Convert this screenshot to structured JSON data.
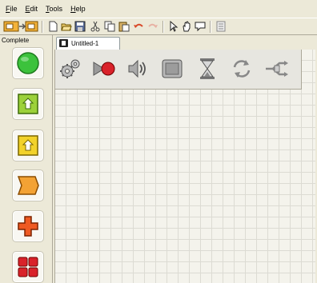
{
  "menu": {
    "file_underline": "F",
    "file_rest": "ile",
    "edit_underline": "E",
    "edit_rest": "dit",
    "tools_underline": "T",
    "tools_rest": "ools",
    "help_underline": "H",
    "help_rest": "elp"
  },
  "palette": {
    "label": "Complete",
    "items": [
      {
        "icon": "green-circle-icon",
        "color": "#3cc23c"
      },
      {
        "icon": "green-arrow-up-icon",
        "color": "#9cd13a"
      },
      {
        "icon": "yellow-arrow-up-icon",
        "color": "#f2d22a"
      },
      {
        "icon": "orange-flag-icon",
        "color": "#f3a234"
      },
      {
        "icon": "orange-cross-icon",
        "color": "#ef5a22"
      },
      {
        "icon": "red-grid-icon",
        "color": "#d9222a"
      }
    ]
  },
  "tabs": [
    {
      "label": "Untitled-1"
    }
  ],
  "blocks": [
    {
      "icon": "gears-icon"
    },
    {
      "icon": "record-play-icon"
    },
    {
      "icon": "speaker-icon"
    },
    {
      "icon": "display-icon"
    },
    {
      "icon": "hourglass-icon"
    },
    {
      "icon": "loop-arrows-icon"
    },
    {
      "icon": "switch-icon"
    }
  ],
  "toolbar": {
    "icons": [
      "program-icon",
      "new-icon",
      "open-icon",
      "save-icon",
      "cut-icon",
      "copy-icon",
      "paste-icon",
      "undo-icon",
      "redo-icon",
      "pointer-icon",
      "hand-icon",
      "comment-icon",
      "config-icon"
    ]
  }
}
